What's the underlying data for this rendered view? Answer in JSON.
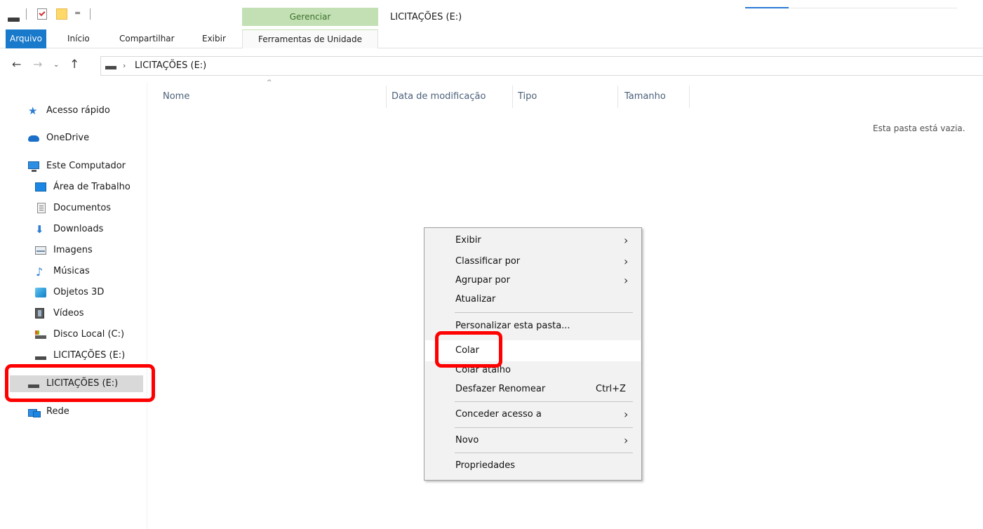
{
  "titlebar": {
    "window_title": "LICITAÇÕES (E:)",
    "quick_access_dropdown": "=",
    "contextual_tab_group": "Gerenciar"
  },
  "ribbon": {
    "tabs": [
      {
        "label": "Arquivo",
        "active": true
      },
      {
        "label": "Início"
      },
      {
        "label": "Compartilhar"
      },
      {
        "label": "Exibir"
      },
      {
        "label": "Ferramentas de Unidade"
      }
    ],
    "accent_color": "#1979ca",
    "contextual_color": "#c2e0b4"
  },
  "address": {
    "back": "←",
    "forward": "→",
    "recent": "⌄",
    "up": "↑",
    "separator": "›",
    "path": "LICITAÇÕES (E:)"
  },
  "sidebar": {
    "items": [
      {
        "label": "Acesso rápido",
        "icon": "star-icon"
      },
      {
        "label": "OneDrive",
        "icon": "cloud-icon"
      },
      {
        "label": "Este Computador",
        "icon": "computer-icon"
      },
      {
        "label": "Área de Trabalho",
        "icon": "desktop-icon"
      },
      {
        "label": "Documentos",
        "icon": "document-icon"
      },
      {
        "label": "Downloads",
        "icon": "download-icon"
      },
      {
        "label": "Imagens",
        "icon": "pictures-icon"
      },
      {
        "label": "Músicas",
        "icon": "music-icon"
      },
      {
        "label": "Objetos 3D",
        "icon": "cube-icon"
      },
      {
        "label": "Vídeos",
        "icon": "video-icon"
      },
      {
        "label": "Disco Local (C:)",
        "icon": "local-disk-icon"
      },
      {
        "label": "LICITAÇÕES (E:)",
        "icon": "drive-icon"
      },
      {
        "label": "LICITAÇÕES (E:)",
        "icon": "drive-icon",
        "selected": true
      },
      {
        "label": "Rede",
        "icon": "network-icon"
      }
    ]
  },
  "filelist": {
    "columns": [
      "Nome",
      "Data de modificação",
      "Tipo",
      "Tamanho"
    ],
    "sort_indicator": "^",
    "empty_message": "Esta pasta está vazia."
  },
  "context_menu": {
    "items": [
      {
        "label": "Exibir",
        "submenu": true
      },
      {
        "label": "Classificar por",
        "submenu": true
      },
      {
        "label": "Agrupar por",
        "submenu": true
      },
      {
        "label": "Atualizar"
      },
      {
        "label": "Personalizar esta pasta..."
      },
      {
        "label": "Colar",
        "hovered": true
      },
      {
        "label": "Colar atalho"
      },
      {
        "label": "Desfazer Renomear",
        "shortcut": "Ctrl+Z"
      },
      {
        "label": "Conceder acesso a",
        "submenu": true
      },
      {
        "label": "Novo",
        "submenu": true
      },
      {
        "label": "Propriedades"
      }
    ],
    "submenu_arrow": "›"
  },
  "annotation_color": "#ff0000"
}
